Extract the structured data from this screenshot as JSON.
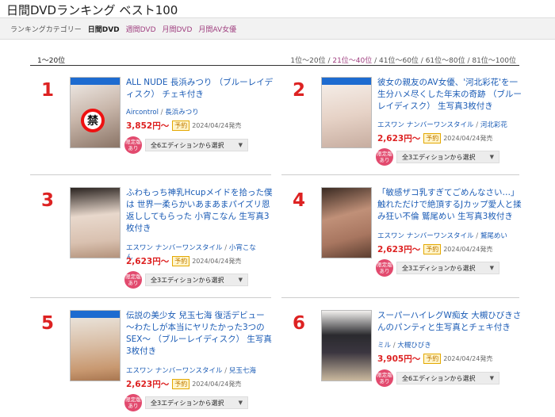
{
  "page": {
    "title": "日間DVDランキング ベスト100"
  },
  "categories": {
    "label": "ランキングカテゴリー",
    "items": [
      {
        "label": "日間DVD"
      },
      {
        "label": "週間DVD"
      },
      {
        "label": "月間DVD"
      },
      {
        "label": "月間AV女優"
      }
    ]
  },
  "range": "1〜20位",
  "pager": [
    "1位〜20位",
    "21位〜40位",
    "41位〜60位",
    "61位〜80位",
    "81位〜100位"
  ],
  "pager_sep": " / ",
  "products": [
    {
      "rank": "1",
      "title": "ALL NUDE 長浜みつり （ブルーレイディスク） チェキ付き",
      "maker": "Aircontrol",
      "actress": "長浜みつり",
      "price": "3,852円〜",
      "badge": "予約",
      "date": "2024/04/24発売",
      "limited": "限定版あり",
      "edition": "全6エディションから選択",
      "cover": "bluray",
      "censored": "禁"
    },
    {
      "rank": "2",
      "title": "彼女の親友のAV女優、'河北彩花'を一生分ハメ尽くした年末の奇跡 （ブルーレイディスク） 生写真3枚付き",
      "maker": "エスワン ナンバーワンスタイル",
      "actress": "河北彩花",
      "price": "2,623円〜",
      "badge": "予約",
      "date": "2024/04/24発売",
      "limited": "限定版あり",
      "edition": "全3エディションから選択",
      "cover": "bluray"
    },
    {
      "rank": "3",
      "title": "ふわもっち神乳Hcupメイドを拾った僕は 世界一柔らかいあまあまパイズリ恩返ししてもらった 小宵こなん 生写真3枚付き",
      "maker": "エスワン ナンバーワンスタイル",
      "actress": "小宵こなん",
      "price": "2,623円〜",
      "badge": "予約",
      "date": "2024/04/24発売",
      "limited": "限定版あり",
      "edition": "全3エディションから選択",
      "cover": "dvd"
    },
    {
      "rank": "4",
      "title": "「敏感ザコ乳すぎてごめんなさい…」触れただけで絶頂するJカップ愛人と揉み狂い不倫 鷲尾めい 生写真3枚付き",
      "maker": "エスワン ナンバーワンスタイル",
      "actress": "鷲尾めい",
      "price": "2,623円〜",
      "badge": "予約",
      "date": "2024/04/24発売",
      "limited": "限定版あり",
      "edition": "全3エディションから選択",
      "cover": "dvd"
    },
    {
      "rank": "5",
      "title": "伝説の美少女 兒玉七海 復活デビュー 〜わたしが本当にヤリたかった3つのSEX〜 （ブルーレイディスク） 生写真3枚付き",
      "maker": "エスワン ナンバーワンスタイル",
      "actress": "兒玉七海",
      "price": "2,623円〜",
      "badge": "予約",
      "date": "2024/04/24発売",
      "limited": "限定版あり",
      "edition": "全3エディションから選択",
      "cover": "bluray"
    },
    {
      "rank": "6",
      "title": "スーパーハイレグW痴女 大槻ひびきさんのパンティと生写真とチェキ付き",
      "maker": "ミル",
      "actress": "大槻ひびき",
      "price": "3,905円〜",
      "badge": "予約",
      "date": "2024/04/24発売",
      "limited": "限定版あり",
      "edition": "全6エディションから選択",
      "cover": "dvd"
    }
  ],
  "colors": {
    "rank": "#dd2222",
    "link": "#1a5bb5",
    "price": "#dd2222",
    "limited": "#e24a6e",
    "category_link": "#a04080"
  }
}
